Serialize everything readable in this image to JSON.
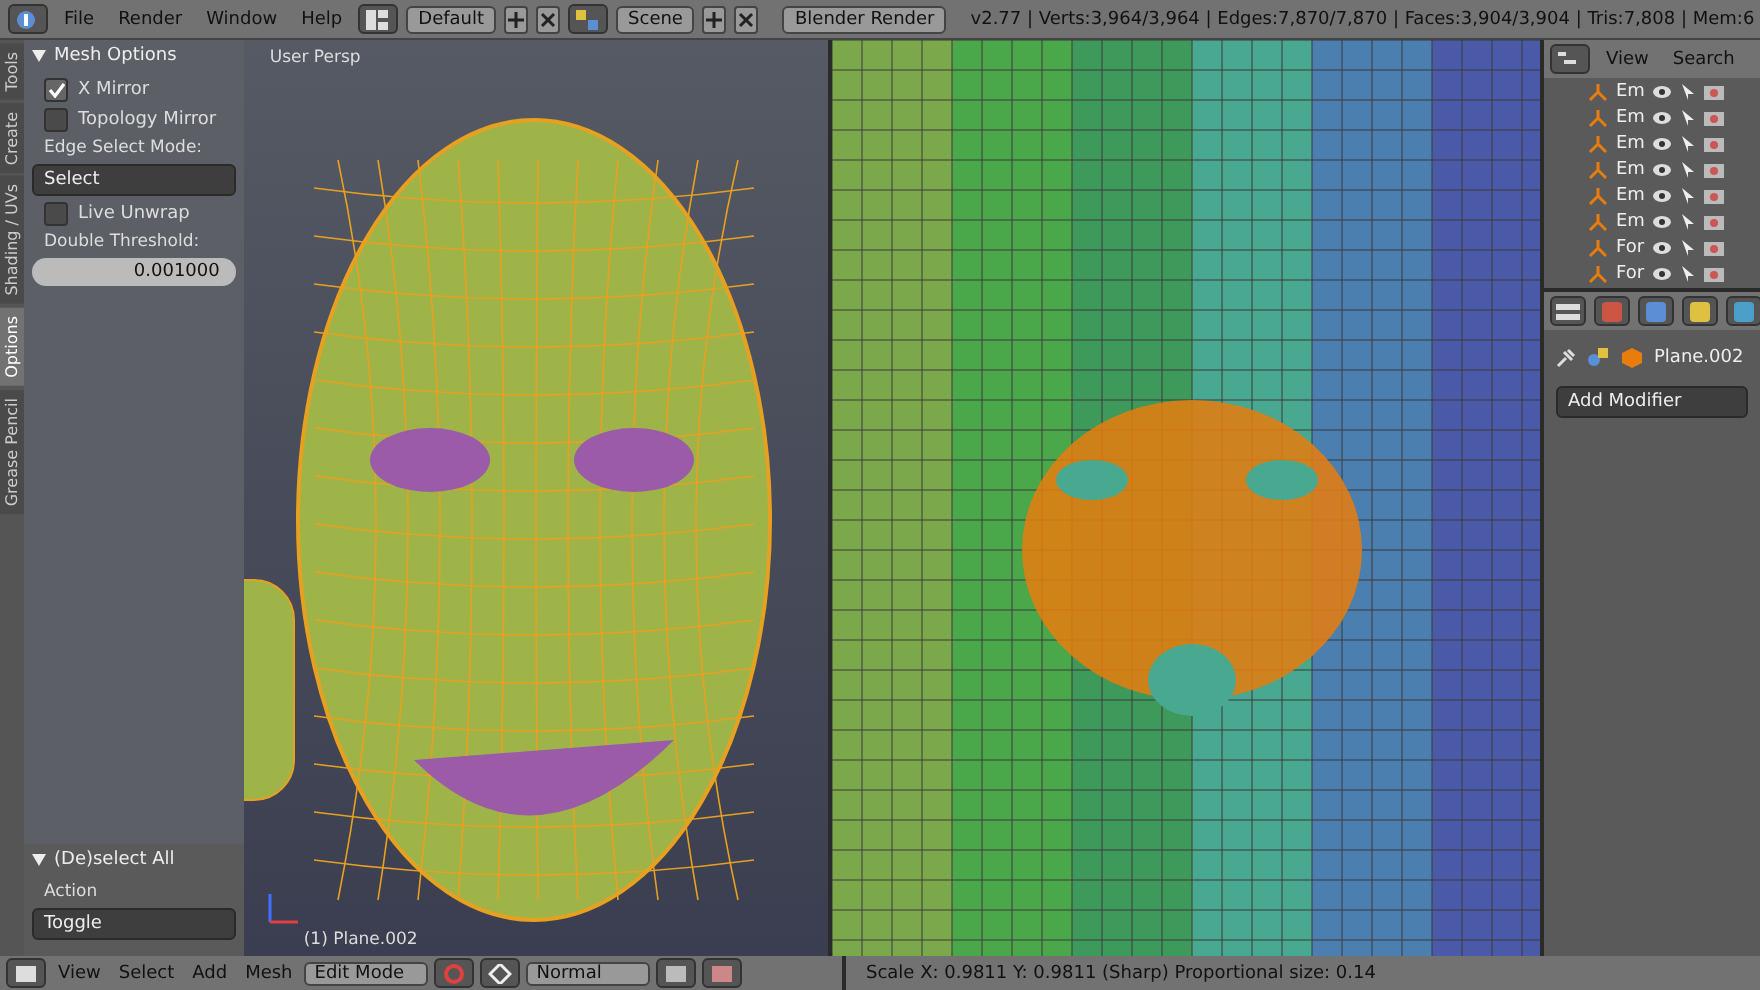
{
  "top_bar": {
    "menus": [
      "File",
      "Render",
      "Window",
      "Help"
    ],
    "layout": "Default",
    "scene": "Scene",
    "engine": "Blender Render",
    "stats": "v2.77 | Verts:3,964/3,964 | Edges:7,870/7,870 | Faces:3,904/3,904 | Tris:7,808 | Mem:6"
  },
  "tool_tabs": [
    {
      "label": "Tools",
      "selected": false
    },
    {
      "label": "Create",
      "selected": false
    },
    {
      "label": "Shading / UVs",
      "selected": false
    },
    {
      "label": "Options",
      "selected": true
    },
    {
      "label": "Grease Pencil",
      "selected": false
    }
  ],
  "mesh_options": {
    "title": "Mesh Options",
    "checks": [
      {
        "label": "X Mirror",
        "checked": true
      },
      {
        "label": "Topology Mirror",
        "checked": false
      }
    ],
    "edge_select_label": "Edge Select Mode:",
    "edge_select": "Select",
    "live_unwrap": {
      "label": "Live Unwrap",
      "checked": false
    },
    "threshold_label": "Double Threshold:",
    "threshold": "0.001000"
  },
  "operator": {
    "title": "(De)select All",
    "action_label": "Action",
    "action": "Toggle"
  },
  "viewport": {
    "view_label": "User Persp",
    "object_label": "(1) Plane.002"
  },
  "outliner": {
    "menus": [
      "View",
      "Search"
    ],
    "rows": [
      {
        "name": "Em"
      },
      {
        "name": "Em"
      },
      {
        "name": "Em"
      },
      {
        "name": "Em"
      },
      {
        "name": "Em"
      },
      {
        "name": "Em"
      },
      {
        "name": "For"
      },
      {
        "name": "For"
      }
    ]
  },
  "properties": {
    "object": "Plane.002",
    "add_modifier": "Add Modifier"
  },
  "bottom_bar": {
    "menus": [
      "View",
      "Select",
      "Add",
      "Mesh"
    ],
    "mode": "Edit Mode",
    "orientation": "Normal",
    "uv_status": "Scale X: 0.9811  Y: 0.9811 (Sharp) Proportional size: 0.14"
  }
}
